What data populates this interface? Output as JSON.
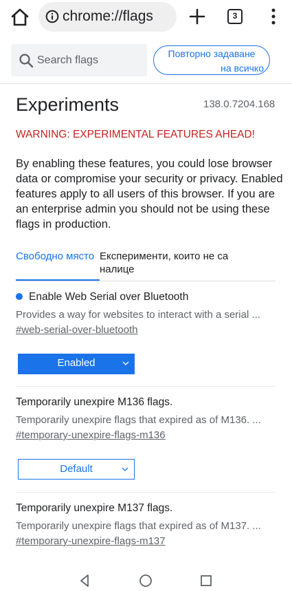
{
  "browser": {
    "url": "chrome://flags",
    "tab_count": "3"
  },
  "header": {
    "search_placeholder": "Search flags",
    "reset_label_line1": "Повторно задаване",
    "reset_label_line2": "на всичко"
  },
  "main": {
    "title": "Experiments",
    "version": "138.0.7204.168",
    "warning": "WARNING: EXPERIMENTAL FEATURES AHEAD!",
    "blurb": "By enabling these features, you could lose browser data or compromise your security or privacy. Enabled features apply to all users of this browser. If you are an enterprise admin you should not be using these flags in production.",
    "tabs": [
      {
        "label": "Свободно място",
        "active": true
      },
      {
        "label": "Експерименти, които не са налице",
        "active": false
      }
    ]
  },
  "experiments": [
    {
      "title": "Enable Web Serial over Bluetooth",
      "description": "Provides a way for websites to interact with a serial ...",
      "link": "#web-serial-over-bluetooth",
      "state": "Enabled",
      "is_enabled": true
    },
    {
      "title": "Temporarily unexpire M136 flags.",
      "description": "Temporarily unexpire flags that expired as of M136. ...",
      "link": "#temporary-unexpire-flags-m136",
      "state": "Default",
      "is_enabled": false
    },
    {
      "title": "Temporarily unexpire M137 flags.",
      "description": "Temporarily unexpire flags that expired as of M137. ...",
      "link": "#temporary-unexpire-flags-m137"
    }
  ],
  "icons": {
    "home": "home-icon",
    "info": "info-icon",
    "new_tab": "plus-icon",
    "menu": "more-vert-icon",
    "search": "search-icon",
    "nav_back": "back-triangle-icon",
    "nav_home": "home-circle-icon",
    "nav_recents": "recents-square-icon"
  },
  "colors": {
    "accent": "#1a73e8",
    "warning": "#c5221f",
    "text": "#202124",
    "secondary_text": "#5f6368"
  }
}
